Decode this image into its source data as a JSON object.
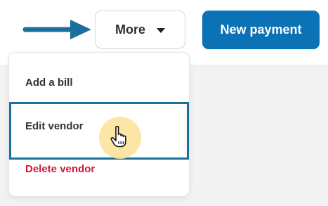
{
  "toolbar": {
    "more_label": "More",
    "new_payment_label": "New payment"
  },
  "menu": {
    "items": [
      {
        "label": "Add a bill"
      },
      {
        "label": "Edit vendor"
      },
      {
        "label": "Delete vendor",
        "color": "#d3173a"
      }
    ]
  },
  "colors": {
    "primary": "#0b72b5",
    "annotation": "#1c6e9c",
    "danger": "#d3173a",
    "cursor_highlight": "#fce296"
  },
  "icons": {
    "arrow": "right-arrow-icon",
    "caret": "caret-down-icon",
    "cursor": "hand-pointer-icon"
  }
}
